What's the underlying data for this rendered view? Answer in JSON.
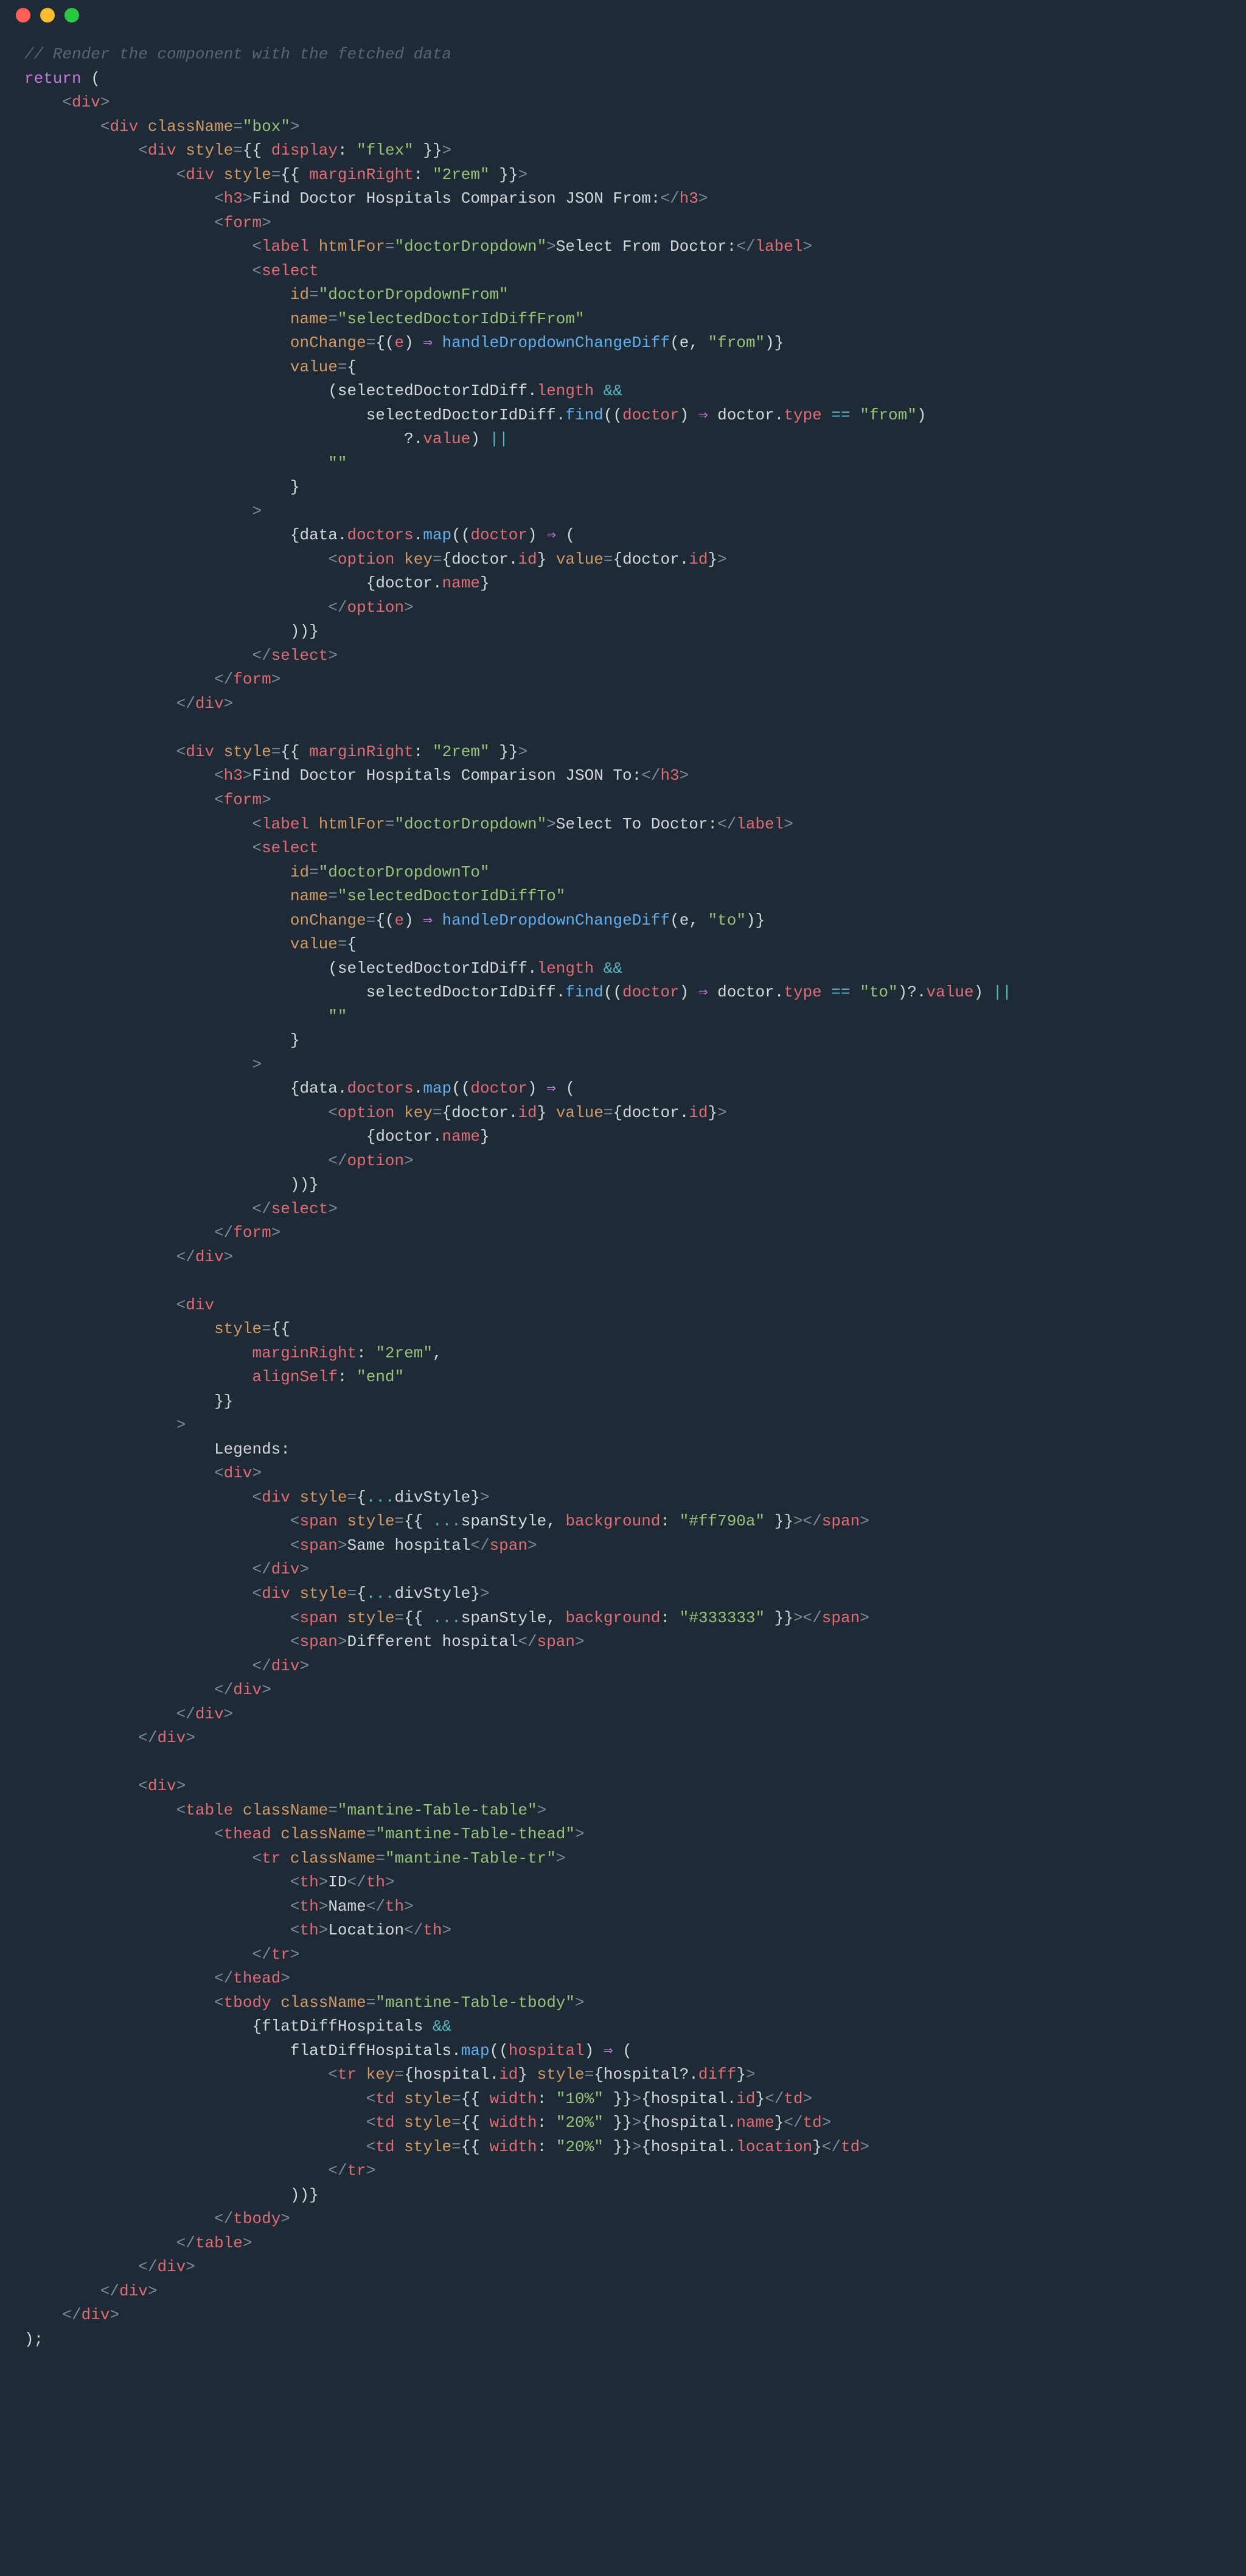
{
  "titlebar": {
    "red": "close",
    "yellow": "minimize",
    "green": "maximize"
  },
  "code": {
    "comment": "// Render the component with the fetched data",
    "kw_return": "return",
    "tag_div": "div",
    "tag_h3": "h3",
    "tag_form": "form",
    "tag_label": "label",
    "tag_select": "select",
    "tag_option": "option",
    "tag_span": "span",
    "tag_table": "table",
    "tag_thead": "thead",
    "tag_tbody": "tbody",
    "tag_tr": "tr",
    "tag_th": "th",
    "tag_td": "td",
    "attr_className": "className",
    "attr_style": "style",
    "attr_htmlFor": "htmlFor",
    "attr_id": "id",
    "attr_name": "name",
    "attr_onChange": "onChange",
    "attr_value": "value",
    "attr_key": "key",
    "val_box": "\"box\"",
    "val_flex": "\"flex\"",
    "val_2rem": "\"2rem\"",
    "val_end": "\"end\"",
    "val_doctorDropdown": "\"doctorDropdown\"",
    "val_doctorDropdownFrom": "\"doctorDropdownFrom\"",
    "val_doctorDropdownTo": "\"doctorDropdownTo\"",
    "val_selFrom": "\"selectedDoctorIdDiffFrom\"",
    "val_selTo": "\"selectedDoctorIdDiffTo\"",
    "val_from": "\"from\"",
    "val_to": "\"to\"",
    "val_empty": "\"\"",
    "val_ff790a": "\"#ff790a\"",
    "val_333333": "\"#333333\"",
    "val_mtable": "\"mantine-Table-table\"",
    "val_mthead": "\"mantine-Table-thead\"",
    "val_mtr": "\"mantine-Table-tr\"",
    "val_mtbody": "\"mantine-Table-tbody\"",
    "val_10pct": "\"10%\"",
    "val_20pct": "\"20%\"",
    "txt_h3from": "Find Doctor Hospitals Comparison JSON From:",
    "txt_h3to": "Find Doctor Hospitals Comparison JSON To:",
    "txt_labelFrom": "Select From Doctor:",
    "txt_labelTo": "Select To Doctor:",
    "txt_legends": "Legends:",
    "txt_same": "Same hospital",
    "txt_diff": "Different hospital",
    "txt_id": "ID",
    "txt_name": "Name",
    "txt_location": "Location",
    "prop_display": "display",
    "prop_marginRight": "marginRight",
    "prop_alignSelf": "alignSelf",
    "prop_background": "background",
    "prop_width": "width",
    "obj_data": "data",
    "obj_doctors": "doctors",
    "obj_doctor": "doctor",
    "obj_hospital": "hospital",
    "obj_flatDiff": "flatDiffHospitals",
    "fn_map": "map",
    "fn_find": "find",
    "fn_handle": "handleDropdownChangeDiff",
    "prop_length": "length",
    "prop_type": "type",
    "prop_value": "value",
    "prop_id": "id",
    "prop_name": "name",
    "prop_location": "location",
    "prop_diff": "diff",
    "var_e": "e",
    "var_divStyle": "divStyle",
    "var_spanStyle": "spanStyle",
    "var_selDiff": "selectedDoctorIdDiff",
    "op_arrow": "⇒",
    "op_eq": "==",
    "op_and": "&&",
    "op_or": "||",
    "op_opt": "?.",
    "op_spread": "..."
  }
}
